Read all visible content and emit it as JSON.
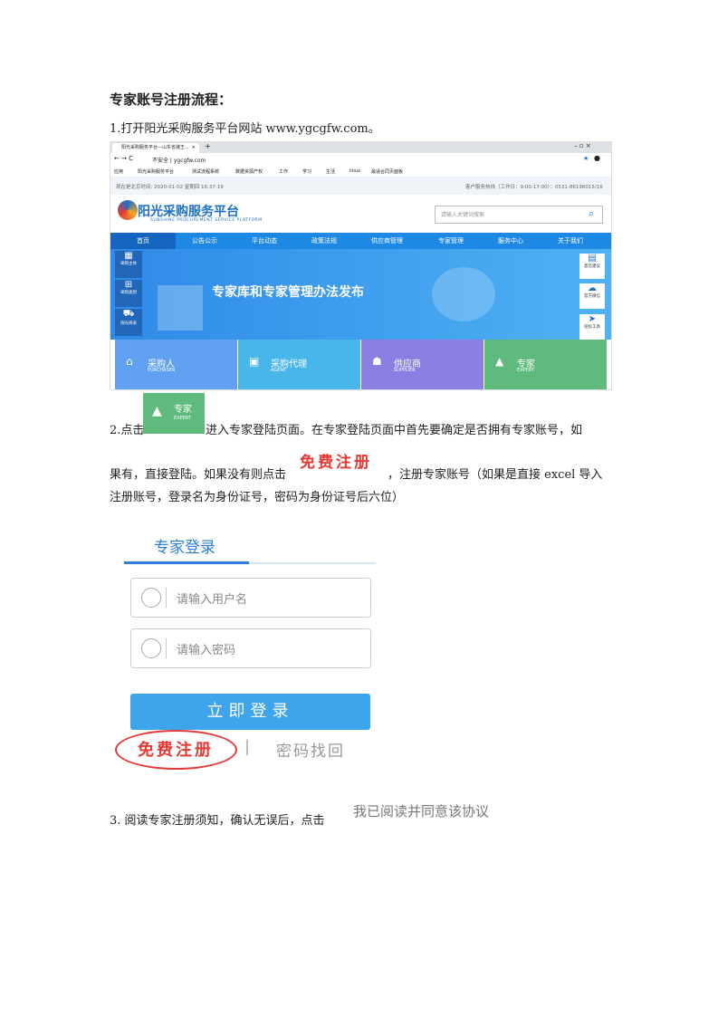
{
  "heading": "专家账号注册流程：",
  "step1": "1.打开阳光采购服务平台网站 www.ygcgfw.com。",
  "browser": {
    "tab_title": "阳光采购服务平台—山东省潍王...",
    "tab_close": "×",
    "new_tab": "+",
    "address": "不安全 | ygcgfw.com",
    "bookmarks": [
      "应用",
      "阳光采购服务平台",
      "测试流程系统",
      "数据资源产权",
      "工作",
      "学习",
      "生活",
      "linux",
      "最适合同页面板"
    ],
    "time_text": "现在是北京时间: 2020-01-02  星期四  16:37:19",
    "hotline": "客户服务热线（工作日：9:00-17:00）：0531-86196015/16",
    "logo_title": "阳光采购服务平台",
    "logo_sub": "SUNSHINE PROCUREMENT SERVICE PLATFORM",
    "search_placeholder": "请输入关键词搜索",
    "nav": [
      "首页",
      "公告公示",
      "平台动态",
      "政策法规",
      "供应商管理",
      "专家管理",
      "服务中心",
      "关于我们"
    ],
    "banner_title": "专家库和专家管理办法发布",
    "left_side": [
      "采购主体",
      "采购类别",
      "阳光商采"
    ],
    "right_side": [
      "意见建议",
      "官方微信",
      "投标工具"
    ],
    "cards": [
      {
        "title": "采购人",
        "en": "PURCHASER",
        "color": "#5fa1f0"
      },
      {
        "title": "采购代理",
        "en": "AGENT",
        "color": "#48b6e8"
      },
      {
        "title": "供应商",
        "en": "SUPPLIER",
        "color": "#8a7fe0"
      },
      {
        "title": "专家",
        "en": "EXPERT",
        "color": "#5fba7d"
      }
    ]
  },
  "step2_a": "2.点击",
  "step2_b": "进入专家登陆页面。在专家登陆页面中首先要确定是否拥有专家账号，如",
  "expert_btn": {
    "title": "专家",
    "en": "EXPERT"
  },
  "step2_c": "果有，直接登陆。如果没有则点击",
  "register_inline": "免费注册",
  "step2_d": "，注册专家账号（如果是直接 excel 导入",
  "step2_e": "注册账号，登录名为身份证号，密码为身份证号后六位）",
  "login": {
    "title": "专家登录",
    "username_placeholder": "请输入用户名",
    "password_placeholder": "请输入密码",
    "login_button": "立即登录",
    "register": "免费注册",
    "separator": "|",
    "forgot": "密码找回"
  },
  "step3": "3.   阅读专家注册须知，确认无误后，点击",
  "agree_button": "我已阅读并同意该协议"
}
